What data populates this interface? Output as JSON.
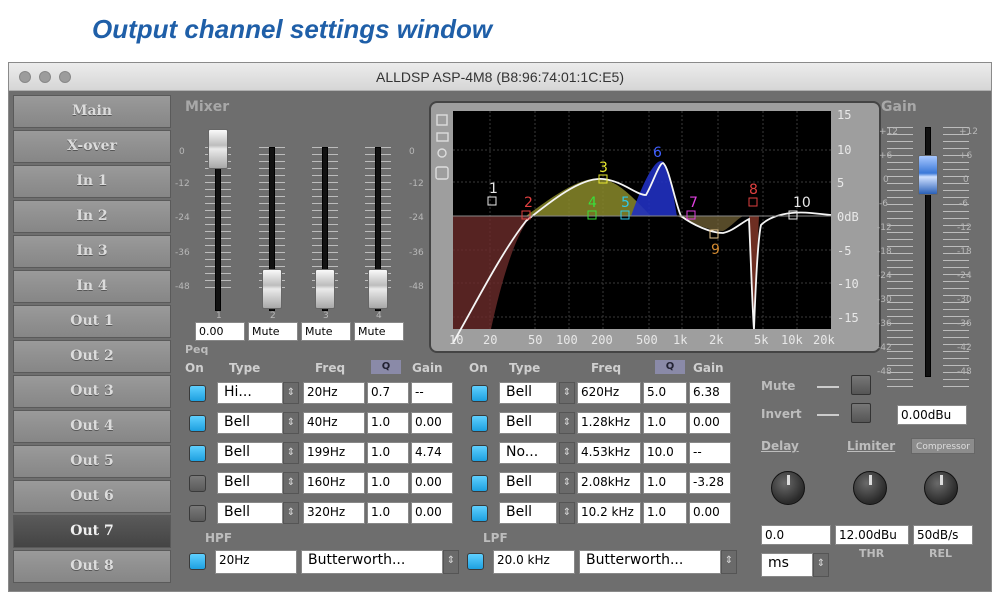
{
  "caption": "Output channel settings window",
  "window_title": "ALLDSP ASP-4M8 (B8:96:74:01:1C:E5)",
  "nav": [
    "Main",
    "X-over",
    "In 1",
    "In 2",
    "In 3",
    "In 4",
    "Out 1",
    "Out 2",
    "Out 3",
    "Out 4",
    "Out 5",
    "Out 6",
    "Out 7",
    "Out 8"
  ],
  "active_nav": "Out 7",
  "mixer": {
    "title": "Mixer",
    "scale": [
      "0",
      "-12",
      "-24",
      "-36",
      "-48"
    ],
    "channels": [
      "1",
      "2",
      "3",
      "4"
    ],
    "values": [
      "0.00",
      "Mute",
      "Mute",
      "Mute"
    ]
  },
  "graph": {
    "y_ticks": [
      "15",
      "10",
      "5",
      "0dB",
      "-5",
      "-10",
      "-15"
    ],
    "x_ticks": [
      "10",
      "20",
      "50",
      "100",
      "200",
      "500",
      "1k",
      "2k",
      "5k",
      "10k",
      "20k"
    ],
    "markers": [
      "1",
      "2",
      "3",
      "4",
      "5",
      "6",
      "7",
      "8",
      "9",
      "10"
    ]
  },
  "gain": {
    "title": "Gain",
    "scale": [
      "+12",
      "+6",
      "0",
      "-6",
      "-12",
      "-18",
      "-24",
      "-30",
      "-36",
      "-42",
      "-48"
    ],
    "value": "0.00dBu"
  },
  "peq": {
    "title": "Peq",
    "headers": [
      "On",
      "Type",
      "Freq",
      "Q",
      "Gain"
    ],
    "left": [
      {
        "on": true,
        "type": "Hi...",
        "freq": "20Hz",
        "q": "0.7",
        "gain": "--"
      },
      {
        "on": true,
        "type": "Bell",
        "freq": "40Hz",
        "q": "1.0",
        "gain": "0.00"
      },
      {
        "on": true,
        "type": "Bell",
        "freq": "199Hz",
        "q": "1.0",
        "gain": "4.74"
      },
      {
        "on": false,
        "type": "Bell",
        "freq": "160Hz",
        "q": "1.0",
        "gain": "0.00"
      },
      {
        "on": false,
        "type": "Bell",
        "freq": "320Hz",
        "q": "1.0",
        "gain": "0.00"
      }
    ],
    "right": [
      {
        "on": true,
        "type": "Bell",
        "freq": "620Hz",
        "q": "5.0",
        "gain": "6.38"
      },
      {
        "on": true,
        "type": "Bell",
        "freq": "1.28kHz",
        "q": "1.0",
        "gain": "0.00"
      },
      {
        "on": true,
        "type": "No...",
        "freq": "4.53kHz",
        "q": "10.0",
        "gain": "--"
      },
      {
        "on": true,
        "type": "Bell",
        "freq": "2.08kHz",
        "q": "1.0",
        "gain": "-3.28"
      },
      {
        "on": true,
        "type": "Bell",
        "freq": "10.2 kHz",
        "q": "1.0",
        "gain": "0.00"
      }
    ]
  },
  "hpf": {
    "label": "HPF",
    "freq": "20Hz",
    "type": "Butterworth..."
  },
  "lpf": {
    "label": "LPF",
    "freq": "20.0 kHz",
    "type": "Butterworth..."
  },
  "controls": {
    "mute": "Mute",
    "invert": "Invert",
    "delay": "Delay",
    "limiter": "Limiter",
    "compressor": "Compressor",
    "delay_value": "0.0",
    "thr_value": "12.00dBu",
    "rel_value": "50dB/s",
    "thr_label": "THR",
    "rel_label": "REL",
    "unit": "ms"
  },
  "colors": {
    "accent": "#1ea0e0",
    "caption": "#1f5fa8"
  }
}
